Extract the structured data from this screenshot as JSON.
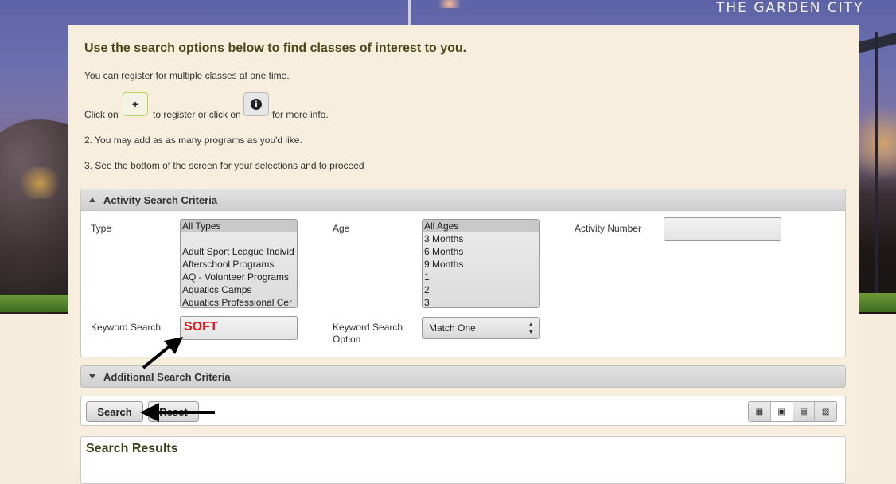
{
  "brand": "THE GARDEN CITY",
  "intro": {
    "headline": "Use the search options below to find classes of interest to you.",
    "line1": "You can register for multiple classes at one time.",
    "click_on_1": "Click on",
    "to_register": "to register or click on",
    "for_info": "for more info.",
    "line2": "2. You may add as as many programs as you'd like.",
    "line3": "3. See the bottom of the screen for your selections and to proceed"
  },
  "activity_section": {
    "title": "Activity Search Criteria",
    "type_label": "Type",
    "type_options": [
      "All Types",
      "",
      "Adult Sport League Individ",
      "Afterschool Programs",
      "AQ - Volunteer Programs",
      "Aquatics Camps",
      "Aquatics Professional Cer"
    ],
    "age_label": "Age",
    "age_options": [
      "All Ages",
      "3 Months",
      "6 Months",
      "9 Months",
      "1",
      "2",
      "3"
    ],
    "activity_number_label": "Activity Number",
    "activity_number_value": "",
    "keyword_label": "Keyword Search",
    "keyword_value": "SOFT",
    "keyword_option_label_1": "Keyword Search",
    "keyword_option_label_2": "Option",
    "keyword_option_value": "Match One"
  },
  "additional_section": {
    "title": "Additional Search Criteria"
  },
  "actions": {
    "search": "Search",
    "reset": "Reset"
  },
  "view_icons": [
    "grid-view-icon",
    "list-view-icon",
    "calendar-view-icon",
    "image-view-icon"
  ],
  "results": {
    "title": "Search Results"
  },
  "colors": {
    "panel": "#f8eedd",
    "keyword_text": "#e5141a",
    "plus_border": "#b7d35a"
  }
}
